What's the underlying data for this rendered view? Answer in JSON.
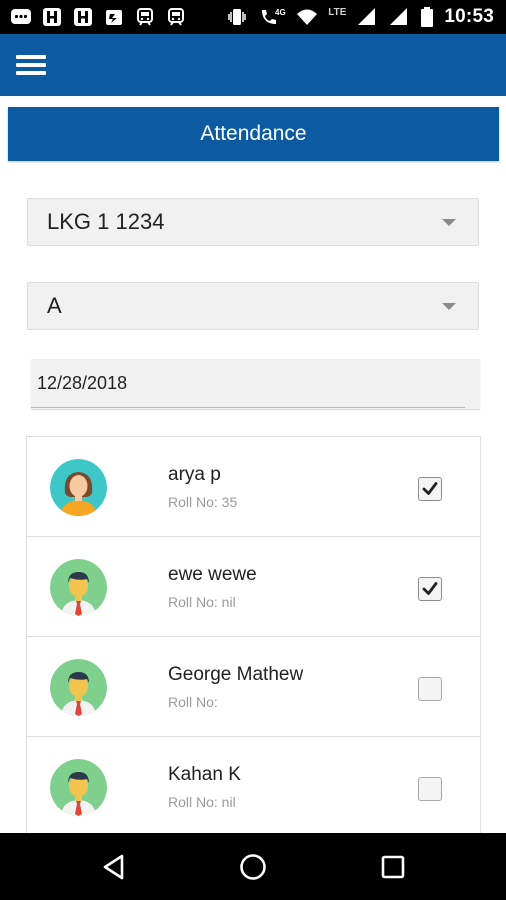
{
  "status_bar": {
    "time": "10:53",
    "network_label": "LTE",
    "data_label": "4G",
    "icons": [
      "messenger-icon",
      "image-icon",
      "image-icon",
      "app-icon",
      "train-icon",
      "train-icon",
      "vibrate-icon",
      "call-icon",
      "wifi-icon",
      "signal-icon",
      "signal-icon",
      "battery-icon"
    ]
  },
  "app_bar": {
    "menu_icon": "hamburger-menu-icon"
  },
  "page": {
    "title": "Attendance"
  },
  "filters": {
    "class_select": "LKG 1 1234",
    "section_select": "A",
    "date": "12/28/2018"
  },
  "students": [
    {
      "name": "arya p",
      "roll": "Roll No: 35",
      "avatar": "female-avatar-icon",
      "present": true
    },
    {
      "name": "ewe wewe",
      "roll": "Roll No: nil",
      "avatar": "male-avatar-icon",
      "present": true
    },
    {
      "name": "George Mathew",
      "roll": "Roll No:",
      "avatar": "male-avatar-icon",
      "present": false
    },
    {
      "name": "Kahan K",
      "roll": "Roll No: nil",
      "avatar": "male-avatar-icon",
      "present": false
    }
  ],
  "nav_bar": {
    "icons": [
      "back-triangle-icon",
      "home-circle-icon",
      "recents-square-icon"
    ]
  },
  "colors": {
    "primary": "#0b5aa2",
    "female_avatar_bg": "#3ec7c7",
    "male_avatar_bg": "#7fd08d",
    "tie": "#e0453b"
  }
}
